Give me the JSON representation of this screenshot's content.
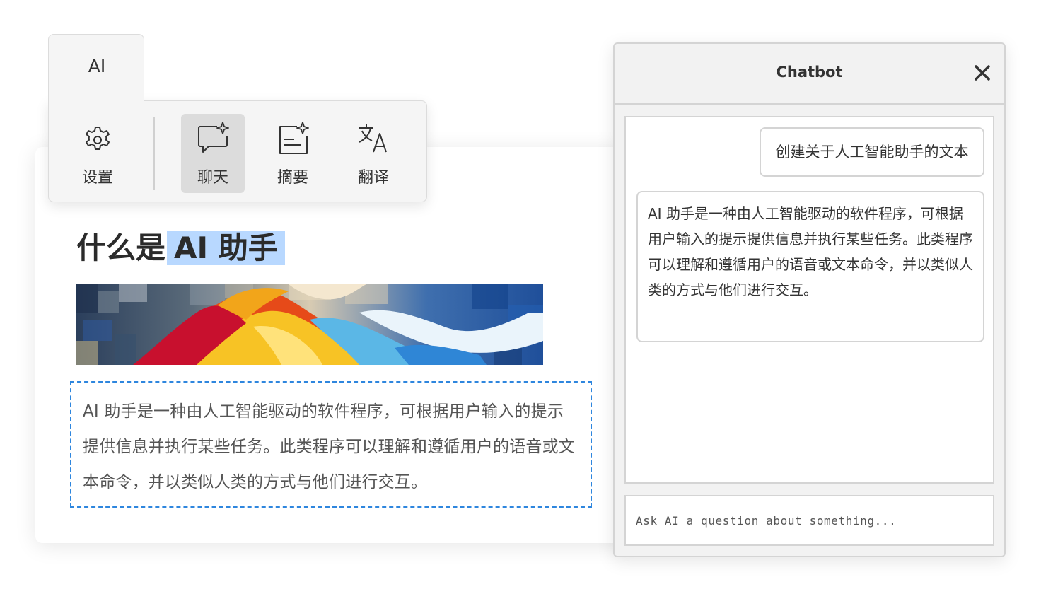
{
  "toolbar": {
    "tab_label": "AI",
    "tools": [
      {
        "label": "设置",
        "icon": "gear-icon"
      },
      {
        "label": "聊天",
        "icon": "chat-sparkle-icon",
        "active": true
      },
      {
        "label": "摘要",
        "icon": "summary-icon"
      },
      {
        "label": "翻译",
        "icon": "translate-icon"
      }
    ]
  },
  "document": {
    "title_prefix": "什么是",
    "title_highlight": "AI 助手",
    "highlight_color": "#b8d8ff",
    "body": "AI 助手是一种由人工智能驱动的软件程序，可根据用户输入的提示提供信息并执行某些任务。此类程序可以理解和遵循用户的语音或文本命令，并以类似人类的方式与他们进行交互。",
    "selection_border_color": "#2e86de"
  },
  "chatbot": {
    "title": "Chatbot",
    "close_icon": "close-icon",
    "messages": [
      {
        "role": "user",
        "text": "创建关于人工智能助手的文本"
      },
      {
        "role": "assistant",
        "text": "AI 助手是一种由人工智能驱动的软件程序，可根据用户输入的提示提供信息并执行某些任务。此类程序可以理解和遵循用户的语音或文本命令，并以类似人类的方式与他们进行交互。"
      }
    ],
    "input_placeholder": "Ask AI a question about something..."
  }
}
